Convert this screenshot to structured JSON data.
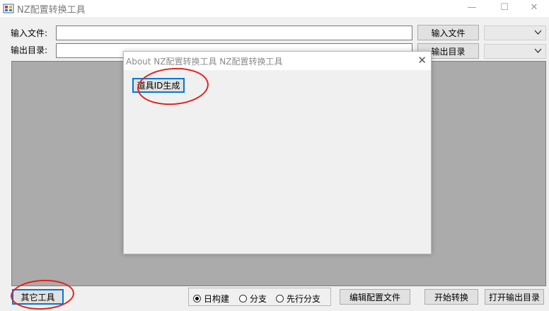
{
  "window": {
    "title": "NZ配置转换工具",
    "minimize": "—",
    "maximize": "☐",
    "close": "✕"
  },
  "form": {
    "input_file_label": "输入文件:",
    "output_dir_label": "输出目录:",
    "input_file_value": "",
    "output_dir_value": "",
    "input_file_button": "输入文件",
    "output_dir_button": "输出目录",
    "input_combo_value": "",
    "output_combo_value": ""
  },
  "dialog": {
    "title": "About NZ配置转换工具 NZ配置转换工具",
    "item_id_button": "道具ID生成",
    "close": "✕"
  },
  "bottom": {
    "other_tools_button": "其它工具",
    "radios": [
      {
        "label": "日构建",
        "selected": true
      },
      {
        "label": "分支",
        "selected": false
      },
      {
        "label": "先行分支",
        "selected": false
      }
    ],
    "edit_config_button": "编辑配置文件",
    "start_convert_button": "开始转换",
    "open_output_button": "打开输出目录"
  },
  "colors": {
    "annotation": "#e5211b",
    "focus_border": "#0078d7",
    "panel": "#ababab"
  }
}
